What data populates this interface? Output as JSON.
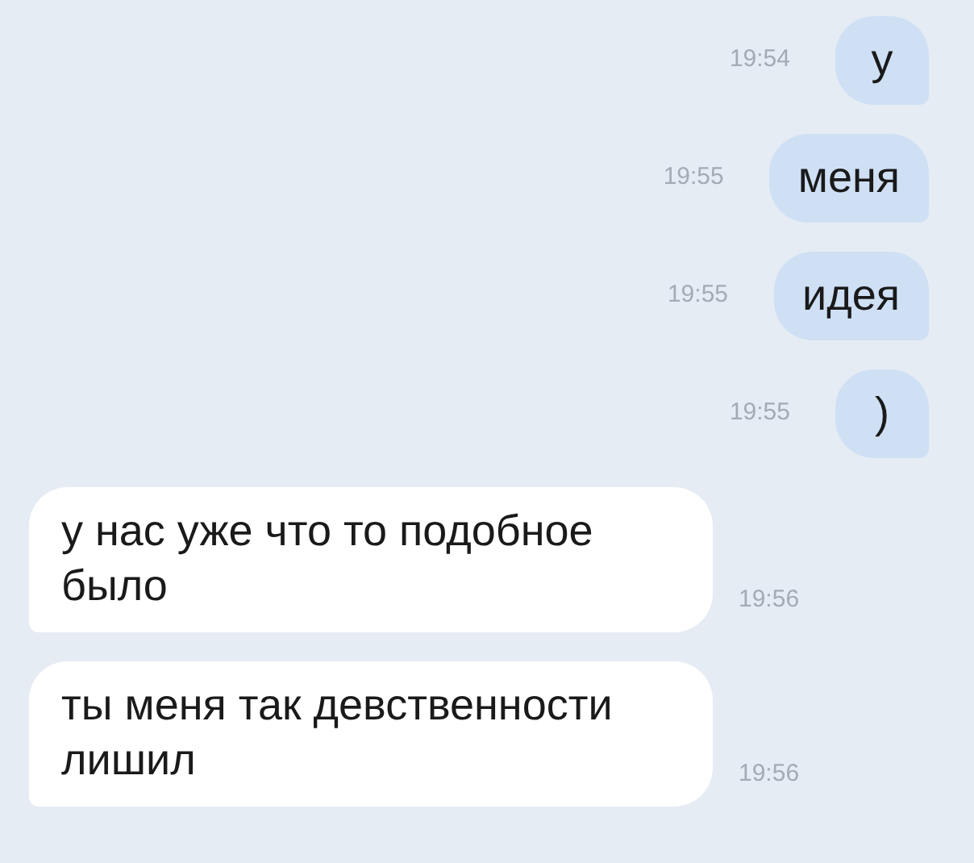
{
  "messages": [
    {
      "kind": "sent",
      "text": "у",
      "time": "19:54"
    },
    {
      "kind": "sent",
      "text": "меня",
      "time": "19:55"
    },
    {
      "kind": "sent",
      "text": "идея",
      "time": "19:55"
    },
    {
      "kind": "sent",
      "text": ")",
      "time": "19:55"
    },
    {
      "kind": "received",
      "text": "у нас уже что то подобное было",
      "time": "19:56"
    },
    {
      "kind": "received",
      "text": "ты меня так девственности лишил",
      "time": "19:56"
    }
  ]
}
